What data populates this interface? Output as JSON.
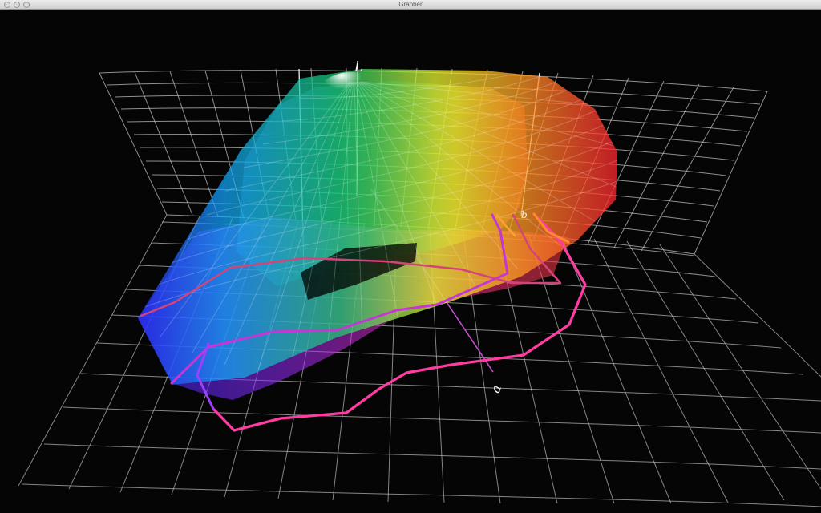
{
  "window": {
    "title": "Grapher"
  },
  "axes": {
    "l_label": "L",
    "a_label": "a",
    "b_label": "b"
  },
  "colors": {
    "background": "#050505",
    "grid": "#bdbdbd"
  }
}
